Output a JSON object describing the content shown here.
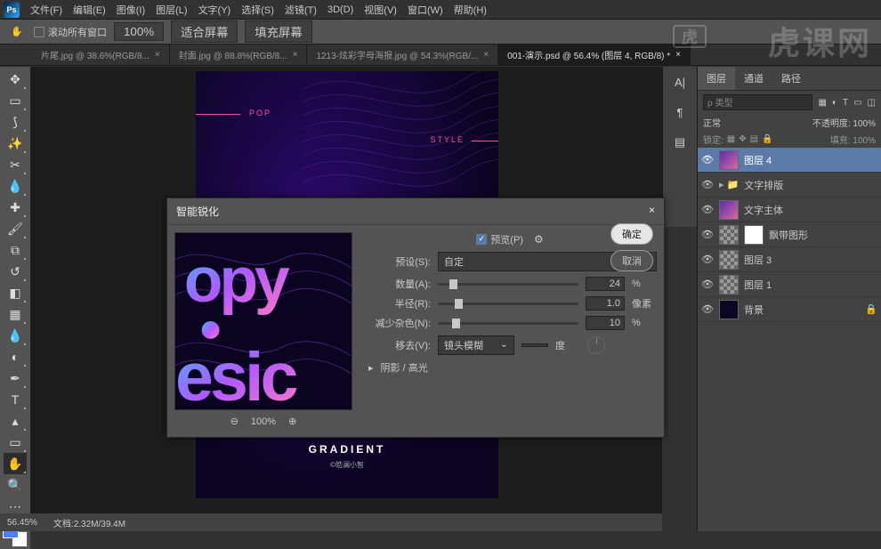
{
  "app": {
    "short": "Ps"
  },
  "menu": [
    "文件(F)",
    "编辑(E)",
    "图像(I)",
    "图层(L)",
    "文字(Y)",
    "选择(S)",
    "滤镜(T)",
    "3D(D)",
    "视图(V)",
    "窗口(W)",
    "帮助(H)"
  ],
  "optbar": {
    "scroll_all": "滚动所有窗口",
    "zoom": "100%",
    "fit": "适合屏幕",
    "fill": "填充屏幕"
  },
  "tabs": [
    {
      "label": "片尾.jpg @ 38.6%(RGB/8...",
      "active": false
    },
    {
      "label": "封面.jpg @ 88.8%(RGB/8...",
      "active": false
    },
    {
      "label": "1213-炫彩字母海报.jpg @ 54.3%(RGB/...",
      "active": false
    },
    {
      "label": "001-演示.psd @ 56.4% (图层 4, RGB/8) *",
      "active": true
    }
  ],
  "doc": {
    "pop": "POP",
    "style": "STYLE",
    "gradient": "GRADIENT",
    "sub": "©皓澜小智"
  },
  "dialog": {
    "title": "智能锐化",
    "close": "×",
    "preview_chk": "预览(P)",
    "preset_lbl": "预设(S):",
    "preset_val": "自定",
    "amount_lbl": "数量(A):",
    "amount_val": "24",
    "amount_unit": "%",
    "radius_lbl": "半径(R):",
    "radius_val": "1.0",
    "radius_unit": "像素",
    "noise_lbl": "减少杂色(N):",
    "noise_val": "10",
    "noise_unit": "%",
    "remove_lbl": "移去(V):",
    "remove_val": "镜头模糊",
    "angle_unit": "度",
    "shadows": "阴影 / 高光",
    "ok": "确定",
    "cancel": "取消",
    "zoom": "100%"
  },
  "panels": {
    "tabs": [
      "图层",
      "通道",
      "路径"
    ],
    "search_ph": "ρ 类型",
    "blend": "正常",
    "opacity_lbl": "不透明度:",
    "opacity_val": "100%",
    "lock_lbl": "锁定:",
    "fill_lbl": "填充:",
    "fill_val": "100%",
    "layers": [
      {
        "name": "图层 4",
        "sel": true,
        "thumb": "grad"
      },
      {
        "name": "文字排版",
        "folder": true
      },
      {
        "name": "文字主体",
        "thumb": "grad"
      },
      {
        "name": "飘带图形",
        "thumb": "checker",
        "mask": true
      },
      {
        "name": "图层 3",
        "thumb": "checker"
      },
      {
        "name": "图层 1",
        "thumb": "checker"
      },
      {
        "name": "背景",
        "thumb": "dark",
        "lock": true
      }
    ]
  },
  "status": {
    "zoom": "56.45%",
    "docinfo": "文档:2.32M/39.4M"
  },
  "watermark": "虎课网"
}
